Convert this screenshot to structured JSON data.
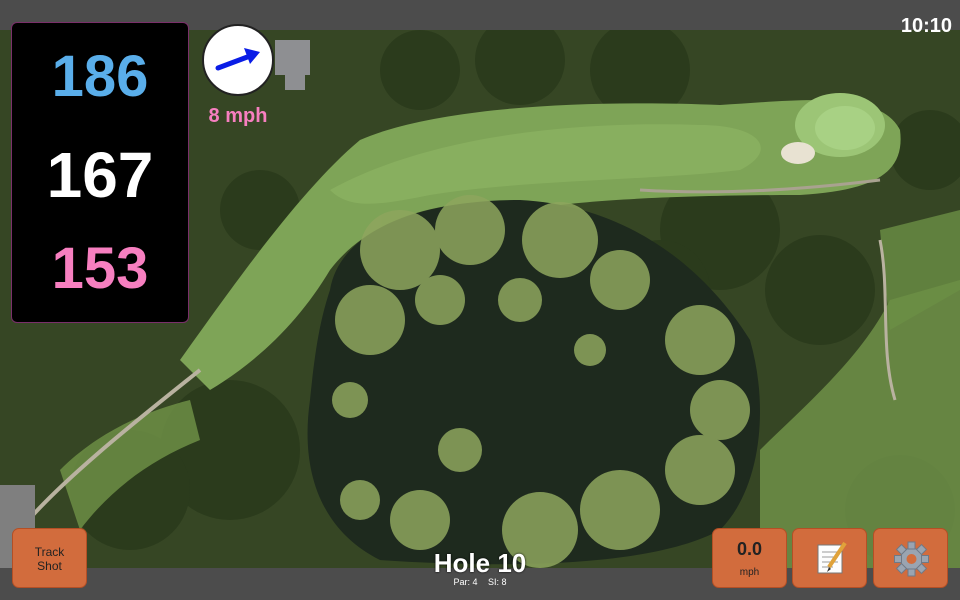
{
  "status_bar": {
    "time": "10:10"
  },
  "yardages": {
    "back": "186",
    "middle": "167",
    "front": "153"
  },
  "wind": {
    "speed_label": "8 mph",
    "direction_icon": "wind-arrow-icon",
    "arrow_color": "#0a1de6"
  },
  "hole": {
    "title": "Hole 10",
    "par": "Par: 4",
    "si": "SI: 8"
  },
  "buttons": {
    "track_shot_line1": "Track",
    "track_shot_line2": "Shot",
    "speed_value": "0.0",
    "speed_unit": "mph",
    "notes_icon": "notepad-icon",
    "settings_icon": "gear-icon"
  },
  "colors": {
    "back_yardage": "#5aaeea",
    "middle_yardage": "#ffffff",
    "front_yardage": "#f77fc0",
    "button": "#d26c3d"
  }
}
